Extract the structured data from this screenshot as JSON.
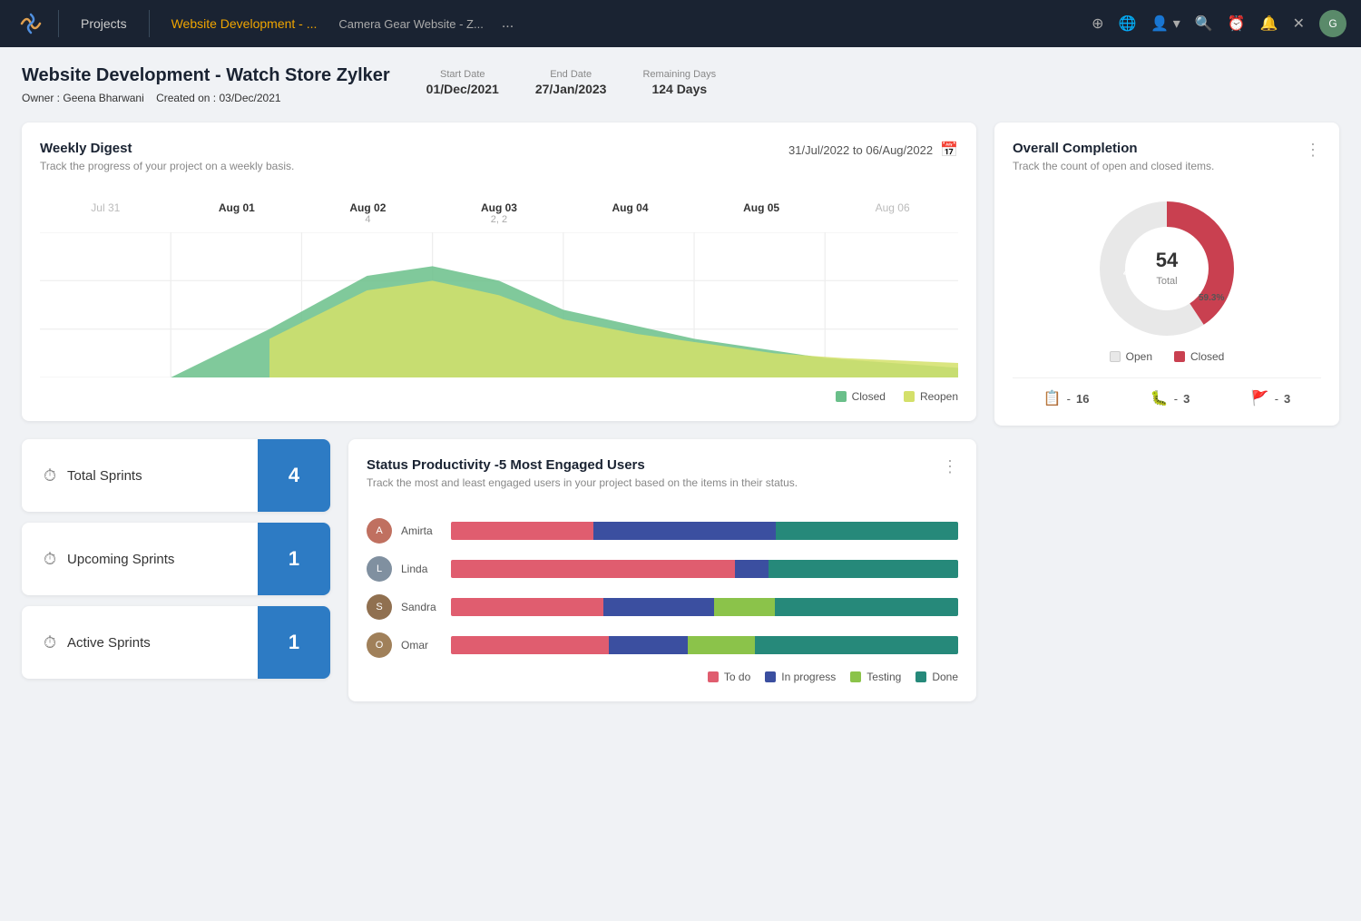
{
  "nav": {
    "logo": "✂",
    "projects_label": "Projects",
    "active_tab": "Website Development - ...",
    "current_tab": "Camera Gear Website - Z...",
    "dots": "...",
    "icons": {
      "add": "⊕",
      "globe": "🌐",
      "user": "👤",
      "search": "🔍",
      "clock": "⏰",
      "bell": "🔔",
      "close": "✕"
    },
    "avatar_initials": "G"
  },
  "project": {
    "title": "Website Development - Watch Store Zylker",
    "owner_label": "Owner :",
    "owner": "Geena Bharwani",
    "created_label": "Created on :",
    "created": "03/Dec/2021",
    "start_date_label": "Start Date",
    "start_date": "01/Dec/2021",
    "end_date_label": "End Date",
    "end_date": "27/Jan/2023",
    "remaining_label": "Remaining Days",
    "remaining": "124 Days"
  },
  "weekly_digest": {
    "title": "Weekly Digest",
    "subtitle": "Track the progress of your project on a weekly basis.",
    "date_range": "31/Jul/2022  to  06/Aug/2022",
    "dates": [
      "Jul 31",
      "Aug 01",
      "Aug 02",
      "Aug 03",
      "Aug 04",
      "Aug 05",
      "Aug 06"
    ],
    "date_notes": [
      "",
      "4",
      "2, 2",
      "",
      "",
      "",
      ""
    ],
    "legend": {
      "closed_label": "Closed",
      "reopen_label": "Reopen"
    }
  },
  "overall_completion": {
    "title": "Overall Completion",
    "subtitle": "Track the count of open and closed items.",
    "total": "54",
    "total_label": "Total",
    "open_pct": "59.3%",
    "closed_pct": "40.7%",
    "legend_open": "Open",
    "legend_closed": "Closed",
    "stat1_icon": "📋",
    "stat1_value": "16",
    "stat2_icon": "🐛",
    "stat2_value": "3",
    "stat3_icon": "🚩",
    "stat3_value": "3"
  },
  "sprints": {
    "total_label": "Total Sprints",
    "total_count": "4",
    "upcoming_label": "Upcoming Sprints",
    "upcoming_count": "1",
    "active_label": "Active Sprints",
    "active_count": "1"
  },
  "productivity": {
    "title": "Status Productivity -5 Most Engaged Users",
    "subtitle": "Track the most and least engaged users in your project based on the items in their status.",
    "users": [
      {
        "name": "Amirta",
        "todo": 28,
        "inprogress": 36,
        "testing": 0,
        "done": 36
      },
      {
        "name": "Linda",
        "todo": 42,
        "inprogress": 5,
        "testing": 0,
        "done": 28
      },
      {
        "name": "Sandra",
        "todo": 25,
        "inprogress": 18,
        "testing": 10,
        "done": 30
      },
      {
        "name": "Omar",
        "todo": 28,
        "inprogress": 14,
        "testing": 12,
        "done": 36
      }
    ],
    "legend": {
      "todo": "To do",
      "inprogress": "In progress",
      "testing": "Testing",
      "done": "Done"
    },
    "colors": {
      "todo": "#e05d6f",
      "inprogress": "#3b4fa0",
      "testing": "#8bc34a",
      "done": "#26897a"
    }
  }
}
